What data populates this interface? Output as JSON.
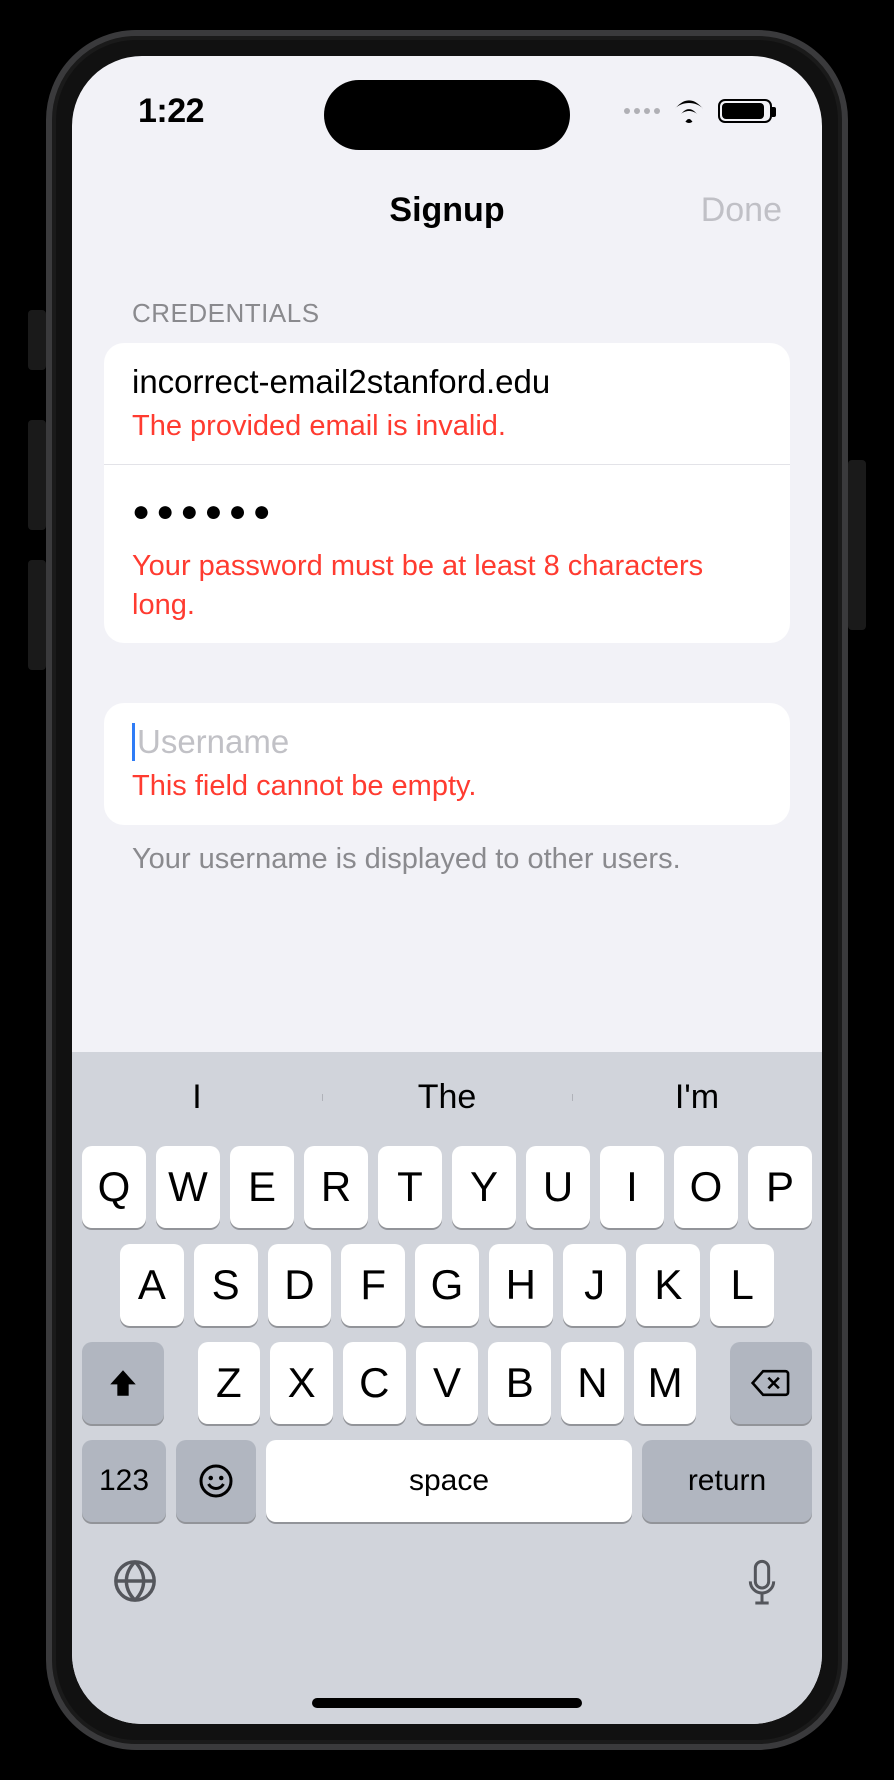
{
  "status": {
    "time": "1:22"
  },
  "nav": {
    "title": "Signup",
    "done": "Done"
  },
  "sections": {
    "credentials": {
      "header": "CREDENTIALS",
      "email": {
        "value": "incorrect-email2stanford.edu",
        "error": "The provided email is invalid."
      },
      "password": {
        "mask": "●●●●●●",
        "error": "Your password must be at least 8 characters long."
      }
    },
    "username": {
      "placeholder": "Username",
      "error": "This field cannot be empty.",
      "footer": "Your username is displayed to other users."
    }
  },
  "keyboard": {
    "suggestions": [
      "I",
      "The",
      "I'm"
    ],
    "rows": [
      [
        "Q",
        "W",
        "E",
        "R",
        "T",
        "Y",
        "U",
        "I",
        "O",
        "P"
      ],
      [
        "A",
        "S",
        "D",
        "F",
        "G",
        "H",
        "J",
        "K",
        "L"
      ],
      [
        "Z",
        "X",
        "C",
        "V",
        "B",
        "N",
        "M"
      ]
    ],
    "numbers": "123",
    "space": "space",
    "return": "return"
  }
}
